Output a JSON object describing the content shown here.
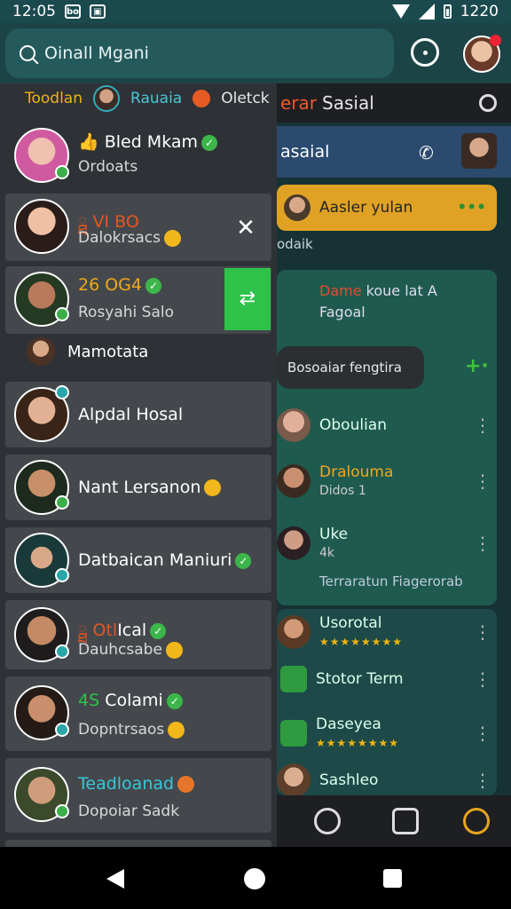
{
  "status": {
    "time": "12:05",
    "battery_text": "1220"
  },
  "search": {
    "placeholder": "Oinall Mgani"
  },
  "right_panel": {
    "title_red": "erar",
    "title_white": "Sasial",
    "sub_title": "asaial",
    "card_text": "Aasler yulan",
    "card_dots": "•••",
    "caption": "odaik",
    "green_line1_red": "Dame",
    "green_line1_rest": "koue lat A",
    "green_line2": "Fagoal",
    "bubble": "Bosoaiar fengtira",
    "plus": "+·",
    "rows": [
      {
        "name": "Oboulian",
        "sub": ""
      },
      {
        "name": "Dralouma",
        "sub": "Didos 1"
      },
      {
        "name": "Uke",
        "sub": "4k"
      },
      {
        "name": "Terraratun Fiagerorab",
        "sub": ""
      },
      {
        "name": "Usorotal",
        "sub": ""
      },
      {
        "name": "Stotor Term",
        "sub": ""
      },
      {
        "name": "Daseyea",
        "sub": ""
      },
      {
        "name": "Sashleo",
        "sub": ""
      }
    ]
  },
  "drawer": {
    "tabs": [
      "Toodlan",
      "Rauaia",
      "Oletck"
    ],
    "items": [
      {
        "prefix": "",
        "name": "Bled Mkam",
        "sub": "Ordoats"
      },
      {
        "prefix": "ྠ VI BO",
        "name": "",
        "sub": "Dalokrsacs"
      },
      {
        "prefix": "26 OG4",
        "name": "",
        "sub": "Rosyahi Salo"
      },
      {
        "prefix": "",
        "name": "Alpdal Hosal",
        "sub": ""
      },
      {
        "prefix": "",
        "name": "Nant Lersanon",
        "sub": ""
      },
      {
        "prefix": "",
        "name": "Datbaican Maniuri",
        "sub": ""
      },
      {
        "prefix": "ྠ Otl",
        "name": "Ical",
        "sub": "Dauhcsabe"
      },
      {
        "prefix": "4S",
        "name": "Colami",
        "sub": "Dopntrsaos"
      },
      {
        "prefix": "Teadloanad",
        "name": "",
        "sub": "Dopoiar Sadk"
      }
    ],
    "section_label": "Mamotata"
  }
}
